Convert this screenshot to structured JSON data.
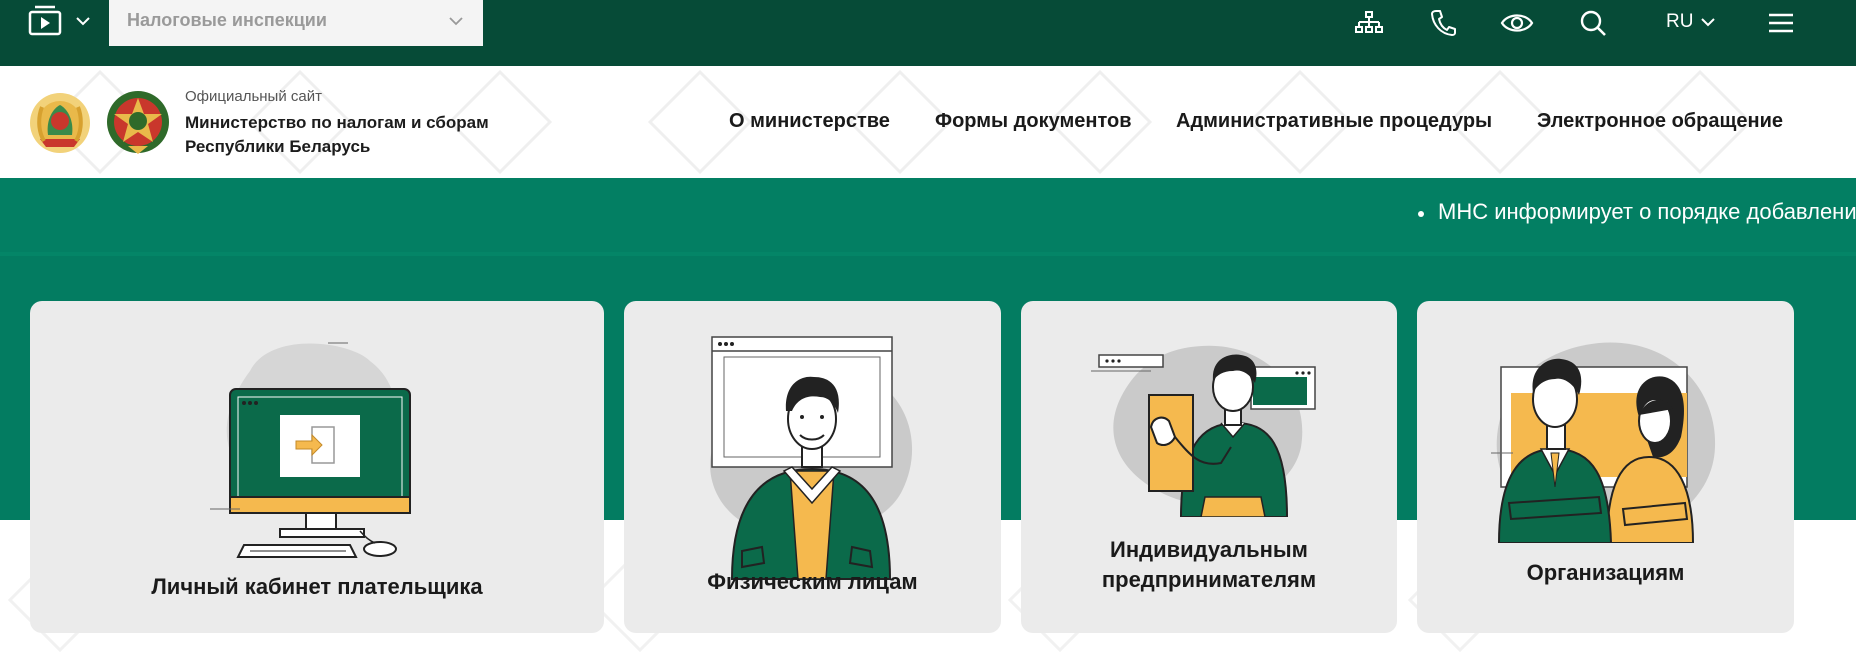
{
  "topbar": {
    "inspections_select": "Налоговые инспекции",
    "icons": [
      "sitemap-icon",
      "phone-icon",
      "eye-icon",
      "search-icon",
      "menu-icon"
    ],
    "language": "RU"
  },
  "header": {
    "site_small": "Официальный сайт",
    "site_name_line1": "Министерство по налогам и сборам",
    "site_name_line2": "Республики Беларусь",
    "nav": [
      "О министерстве",
      "Формы документов",
      "Административные процедуры",
      "Электронное обращение"
    ]
  },
  "ticker": {
    "text": "МНС информирует о порядке добавления"
  },
  "cards": [
    {
      "title": "Личный кабинет плательщика"
    },
    {
      "title": "Физическим лицам"
    },
    {
      "title_line1": "Индивидуальным",
      "title_line2": "предпринимателям"
    },
    {
      "title": "Организациям"
    }
  ],
  "colors": {
    "topbar": "#064b37",
    "ticker": "#037f63",
    "band": "#037c61",
    "card": "#ebebeb",
    "accent_yellow": "#f5b94e",
    "accent_green": "#0b6a4a"
  }
}
